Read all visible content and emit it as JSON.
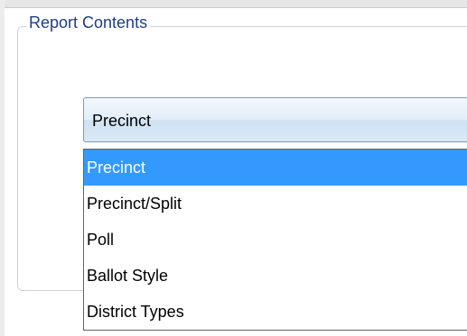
{
  "group": {
    "title": "Report Contents"
  },
  "combo": {
    "value": "Precinct"
  },
  "dropdown": {
    "options": [
      "Precinct",
      "Precinct/Split",
      "Poll",
      "Ballot Style",
      "District Types"
    ],
    "selected_index": 0
  },
  "colors": {
    "selection": "#3399ff",
    "title": "#1d3f86"
  }
}
